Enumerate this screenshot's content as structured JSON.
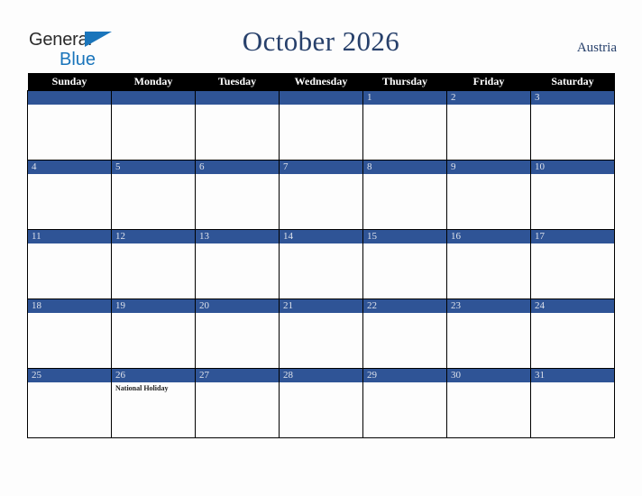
{
  "brand": {
    "line1": "General",
    "line2": "Blue",
    "triangle_icon": "triangle-icon",
    "color_dark": "#2b2b2b",
    "color_blue": "#1a75bb"
  },
  "header": {
    "title": "October 2026",
    "country": "Austria",
    "title_color": "#27406b"
  },
  "calendar": {
    "weekday_headers": [
      "Sunday",
      "Monday",
      "Tuesday",
      "Wednesday",
      "Thursday",
      "Friday",
      "Saturday"
    ],
    "header_bg": "#000000",
    "daynum_bar_bg": "#2f5496",
    "daynum_text_color": "#dfe3ec",
    "cell_bg": "#fdfdfd",
    "weeks": [
      [
        {
          "day": "",
          "events": []
        },
        {
          "day": "",
          "events": []
        },
        {
          "day": "",
          "events": []
        },
        {
          "day": "",
          "events": []
        },
        {
          "day": "1",
          "events": []
        },
        {
          "day": "2",
          "events": []
        },
        {
          "day": "3",
          "events": []
        }
      ],
      [
        {
          "day": "4",
          "events": []
        },
        {
          "day": "5",
          "events": []
        },
        {
          "day": "6",
          "events": []
        },
        {
          "day": "7",
          "events": []
        },
        {
          "day": "8",
          "events": []
        },
        {
          "day": "9",
          "events": []
        },
        {
          "day": "10",
          "events": []
        }
      ],
      [
        {
          "day": "11",
          "events": []
        },
        {
          "day": "12",
          "events": []
        },
        {
          "day": "13",
          "events": []
        },
        {
          "day": "14",
          "events": []
        },
        {
          "day": "15",
          "events": []
        },
        {
          "day": "16",
          "events": []
        },
        {
          "day": "17",
          "events": []
        }
      ],
      [
        {
          "day": "18",
          "events": []
        },
        {
          "day": "19",
          "events": []
        },
        {
          "day": "20",
          "events": []
        },
        {
          "day": "21",
          "events": []
        },
        {
          "day": "22",
          "events": []
        },
        {
          "day": "23",
          "events": []
        },
        {
          "day": "24",
          "events": []
        }
      ],
      [
        {
          "day": "25",
          "events": []
        },
        {
          "day": "26",
          "events": [
            "National Holiday"
          ]
        },
        {
          "day": "27",
          "events": []
        },
        {
          "day": "28",
          "events": []
        },
        {
          "day": "29",
          "events": []
        },
        {
          "day": "30",
          "events": []
        },
        {
          "day": "31",
          "events": []
        }
      ]
    ]
  }
}
